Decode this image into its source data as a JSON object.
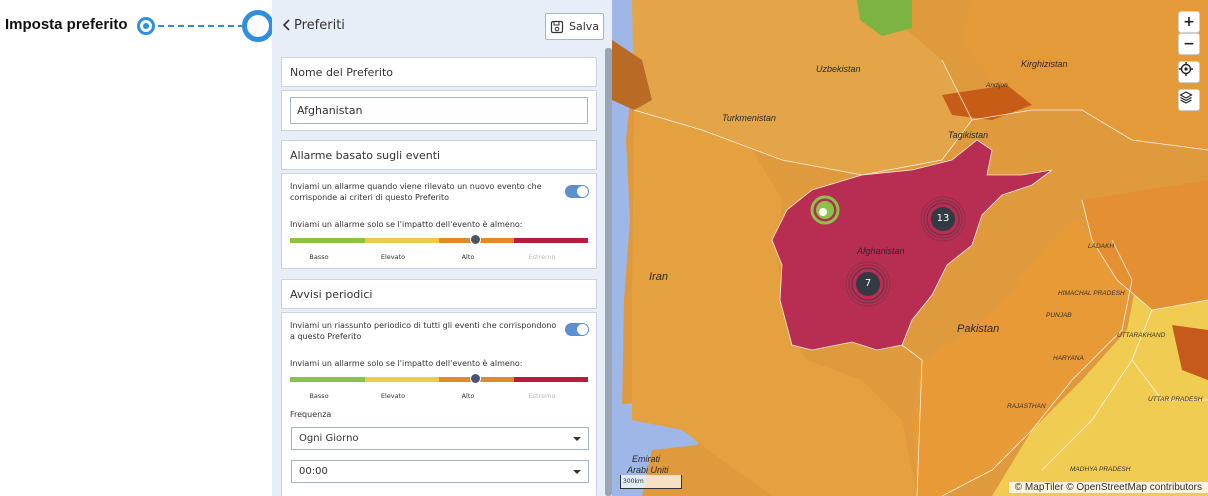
{
  "callout": {
    "label": "Imposta preferito"
  },
  "panel": {
    "title": "Preferiti",
    "save_label": "Salva",
    "name_section": {
      "title": "Nome del Preferito",
      "value": "Afghanistan"
    },
    "event_alarm": {
      "title": "Allarme basato sugli eventi",
      "toggle_text": "Inviami un allarme quando viene rilevato un nuovo evento che corrisponde ai criteri di questo Preferito",
      "toggle_on": true,
      "impact_text": "Inviami un allarme solo se l'impatto dell'evento è almeno:",
      "levels": [
        "Basso",
        "Elevato",
        "Alto",
        "Estremo"
      ],
      "selected_level": "Alto"
    },
    "periodic": {
      "title": "Avvisi periodici",
      "toggle_text": "Inviami un riassunto periodico di tutti gli eventi che corrispondono a questo Preferito",
      "toggle_on": true,
      "impact_text": "Inviami un allarme solo se l'impatto dell'evento è almeno:",
      "levels": [
        "Basso",
        "Elevato",
        "Alto",
        "Estremo"
      ],
      "selected_level": "Alto",
      "frequency_label": "Frequenza",
      "frequency_value": "Ogni Giorno",
      "time_value": "00:00"
    }
  },
  "level_colors": [
    "#8bc34a",
    "#f0c94a",
    "#e08a2c",
    "#b71c3c"
  ],
  "map": {
    "places": {
      "uzbekistan": "Uzbekistan",
      "kirghizistan": "Kirghizistan",
      "andijon": "Andijon",
      "turkmenistan": "Turkmenistan",
      "tagikistan": "Tagikistan",
      "afghanistan": "Afghanistan",
      "iran": "Iran",
      "pakistan": "Pakistan",
      "ladakh": "LADAKH",
      "himachal": "HIMACHAL PRADESH",
      "punjab": "PUNJAB",
      "uttarakhand": "UTTARAKHAND",
      "haryana": "HARYANA",
      "rajasthan": "RAJASTHAN",
      "uttar_pradesh": "UTTAR PRADESH",
      "madhya_pradesh": "MADHYA PRADESH",
      "emirati": "Emirati",
      "arabi_uniti": "Arabi Uniti"
    },
    "clusters": {
      "north": "13",
      "south": "7"
    },
    "scale": "300km",
    "attribution": "© MapTiler © OpenStreetMap contributors",
    "zoom_in": "+",
    "zoom_out": "−"
  }
}
